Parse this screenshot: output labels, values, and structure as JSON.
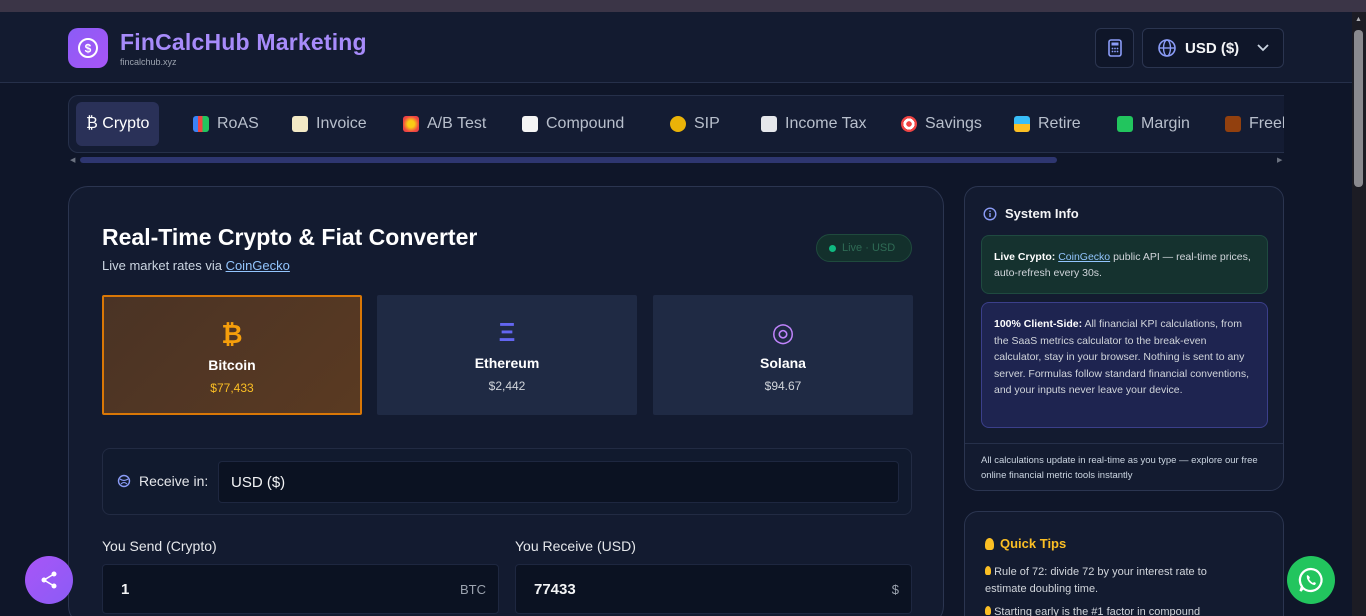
{
  "header": {
    "app_title": "FinCalcHub Marketing",
    "app_domain": "fincalchub.xyz",
    "currency_selector": "USD ($)"
  },
  "tabs": [
    {
      "label": "₿ Crypto",
      "active": true
    },
    {
      "label": "RoAS"
    },
    {
      "label": "Invoice"
    },
    {
      "label": "A/B Test"
    },
    {
      "label": "Compound"
    },
    {
      "label": "SIP"
    },
    {
      "label": "Income Tax"
    },
    {
      "label": "Savings"
    },
    {
      "label": "Retire"
    },
    {
      "label": "Margin"
    },
    {
      "label": "Freel"
    }
  ],
  "converter": {
    "title": "Real-Time Crypto & Fiat Converter",
    "subtitle_prefix": "Live market rates via",
    "subtitle_link": "CoinGecko",
    "live_badge": "Live · USD",
    "coins": [
      {
        "symbol": "₿",
        "name": "Bitcoin",
        "price": "$77,433",
        "selected": true,
        "color": "#f59e0b"
      },
      {
        "symbol": "Ξ",
        "name": "Ethereum",
        "price": "$2,442",
        "color": "#6366f1"
      },
      {
        "symbol": "◎",
        "name": "Solana",
        "price": "$94.67",
        "color": "#c084fc"
      }
    ],
    "receive_label": "Receive in:",
    "receive_value": "USD ($)",
    "send_label": "You Send (Crypto)",
    "send_value": "1",
    "send_unit": "BTC",
    "receive_amount_label": "You Receive (USD)",
    "receive_amount_value": "77433",
    "receive_amount_unit": "$"
  },
  "system_info": {
    "title": "System Info",
    "box1_bold": "Live Crypto:",
    "box1_link": "CoinGecko",
    "box1_text": "public API — real-time prices, auto-refresh every 30s.",
    "box2_bold": "100% Client-Side:",
    "box2_text": "All financial KPI calculations, from the SaaS metrics calculator to the break-even calculator, stay in your browser. Nothing is sent to any server. Formulas follow standard financial conventions, and your inputs never leave your device.",
    "footer": "All calculations update in real-time as you type — explore our free online financial metric tools instantly"
  },
  "tips": {
    "title": "Quick Tips",
    "items": [
      "Rule of 72: divide 72 by your interest rate to estimate doubling time.",
      "Starting early is the #1 factor in compound"
    ]
  }
}
